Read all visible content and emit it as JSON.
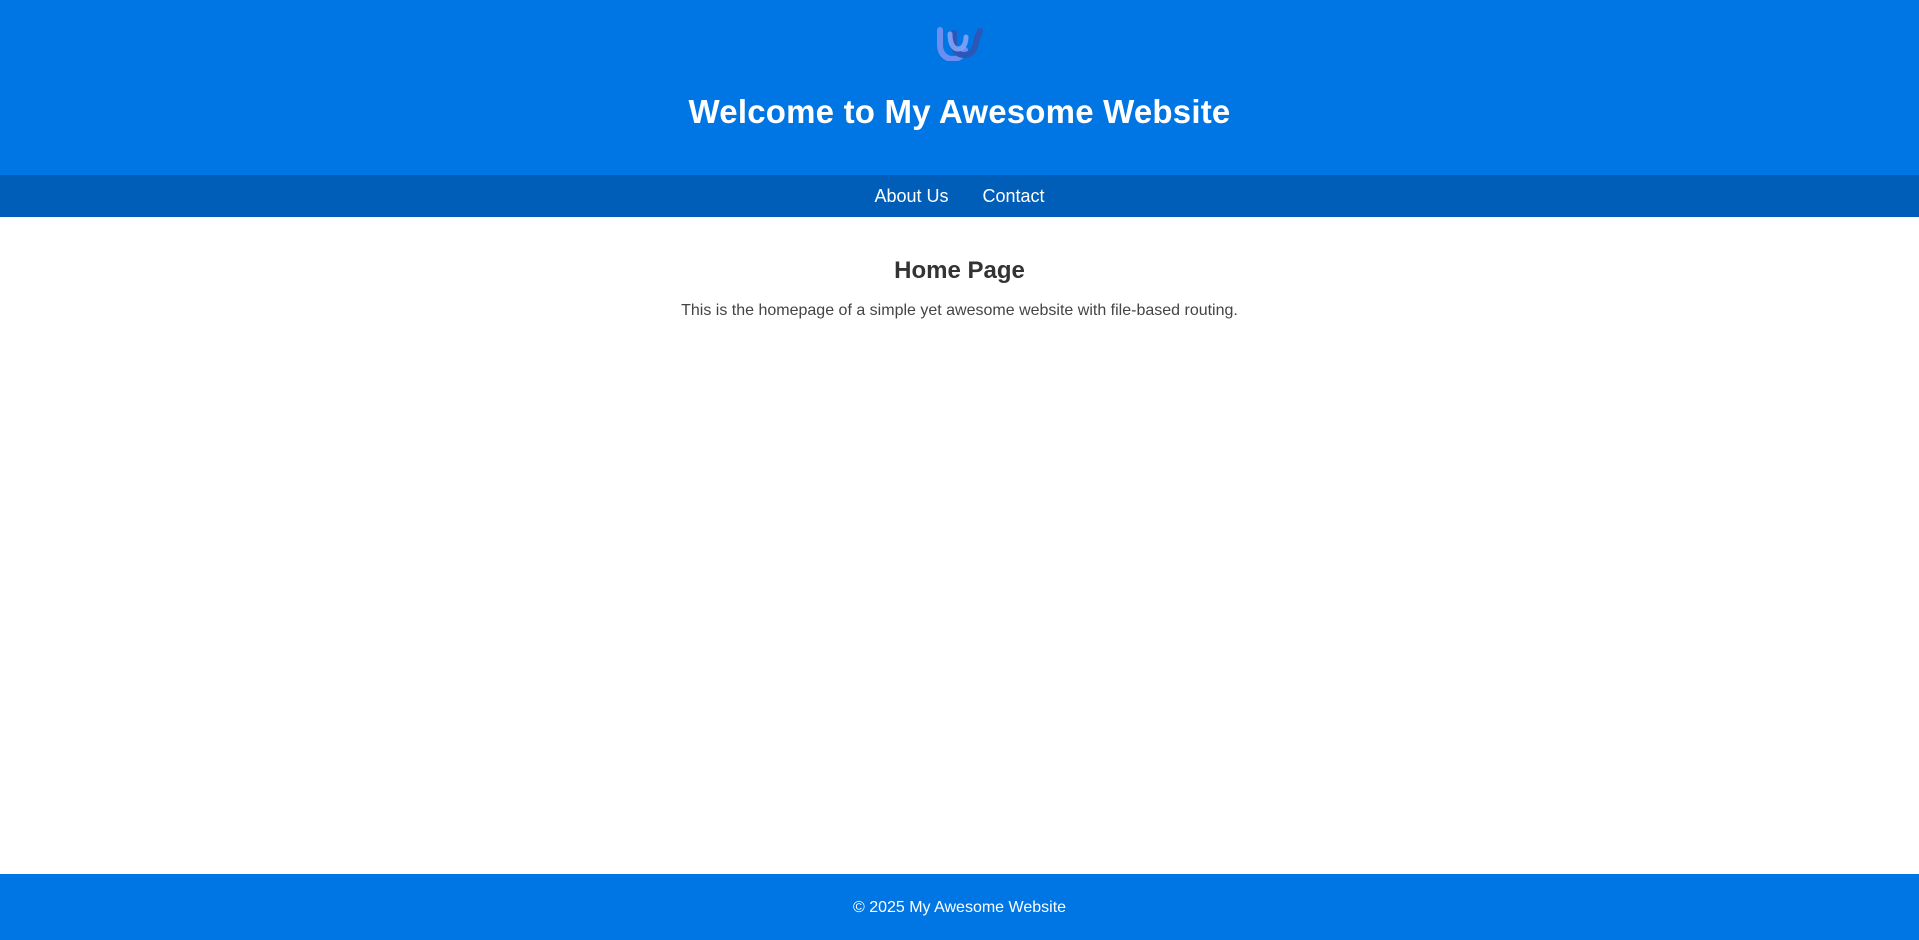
{
  "header": {
    "logo_icon": "u-shaped-logo-icon",
    "title": "Welcome to My Awesome Website"
  },
  "nav": {
    "items": [
      {
        "label": "About Us"
      },
      {
        "label": "Contact"
      }
    ]
  },
  "main": {
    "heading": "Home Page",
    "text": "This is the homepage of a simple yet awesome website with file-based routing."
  },
  "footer": {
    "text": "© 2025 My Awesome Website"
  },
  "colors": {
    "header_bg": "#0075e4",
    "nav_bg": "#005db8",
    "footer_bg": "#0075e4",
    "logo_light": "#6c8ef0",
    "logo_dark": "#2c56b8"
  }
}
